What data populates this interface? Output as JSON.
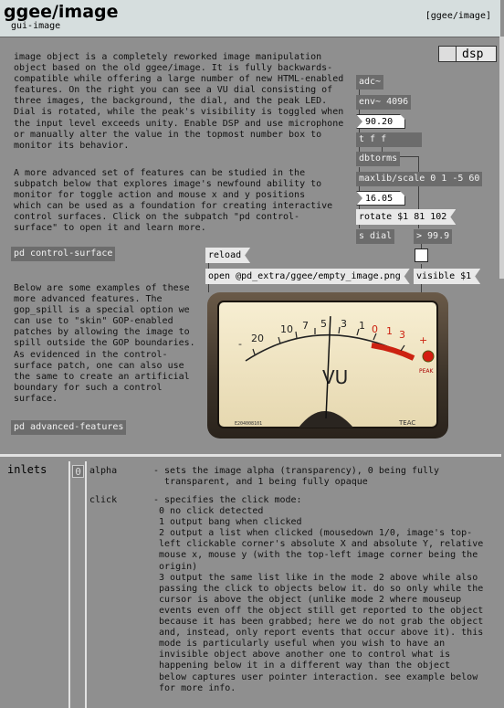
{
  "header": {
    "title": "ggee/image",
    "subtitle": "gui-image",
    "tag": "[ggee/image]"
  },
  "dsp": {
    "label": "dsp"
  },
  "intro_text": "image object is a completely reworked image manipulation\nobject based on the old ggee/image. It is fully backwards-\ncompatible while offering a large number of new HTML-enabled\nfeatures. On the right you can see a VU dial consisting of\nthree images, the background, the dial, and the peak LED.\nDial is rotated, while the peak's visibility is toggled when\nthe input level exceeds unity. Enable DSP and use microphone\nor manually alter the value in the topmost number box to\nmonitor its behavior.",
  "advanced_text": "A more advanced set of features can be studied in the\nsubpatch below that explores image's newfound ability to\nmonitor for toggle action and mouse x and y positions\nwhich can be used as a foundation for creating interactive\ncontrol surfaces. Click on the subpatch \"pd control-\nsurface\" to open it and learn more.",
  "pd_control_surface": "pd control-surface",
  "examples_text": "Below are some examples of these\nmore advanced features. The\ngop_spill is a special option we\ncan use to \"skin\" GOP-enabled\npatches by allowing the image to\nspill outside the GOP boundaries.\nAs evidenced in the control-\nsurface patch, one can also use\nthe same to create an artificial\nboundary for such a control\nsurface.",
  "pd_advanced_features": "pd advanced-features",
  "patch": {
    "adc": "adc~",
    "env": "env~ 4096",
    "num1": "90.20",
    "tff": "t f f",
    "dbtorms": "dbtorms",
    "scale": "maxlib/scale 0 1 -5 60",
    "num2": "16.05",
    "rotate": "rotate $1 81 102",
    "sdial": "s dial",
    "gt": "> 99.9",
    "reload": "reload",
    "open": "open @pd_extra/ggee/empty_image.png",
    "visible": "visible $1"
  },
  "meter": {
    "scale_left": [
      "20",
      "10",
      "7",
      "5",
      "3",
      "1"
    ],
    "scale_right": [
      "0",
      "1",
      "3"
    ],
    "minus": "-",
    "plus": "+",
    "vu_label": "VU",
    "peak_label": "PEAK",
    "serial": "E204008101",
    "brand": "TEAC",
    "needle_db": -8
  },
  "inlets": {
    "section": "inlets",
    "index": "0",
    "rows": [
      {
        "name": "alpha",
        "desc": "- sets the image alpha (transparency), 0 being fully\n  transparent, and 1 being fully opaque"
      },
      {
        "name": "click",
        "desc": "- specifies the click mode:\n 0 no click detected\n 1 output bang when clicked\n 2 output a list when clicked (mousedown 1/0, image's top-\n left clickable corner's absolute X and absolute Y, relative\n mouse x, mouse y (with the top-left image corner being the\n origin)\n 3 output the same list like in the mode 2 above while also\n passing the click to objects below it. do so only while the\n cursor is above the object (unlike mode 2 where mouseup\n events even off the object still get reported to the object\n because it has been grabbed; here we do not grab the object\n and, instead, only report events that occur above it). this\n mode is particularly useful when you wish to have an\n invisible object above another one to control what is\n happening below it in a different way than the object\n below captures user pointer interaction. see example below\n for more info."
      }
    ]
  }
}
